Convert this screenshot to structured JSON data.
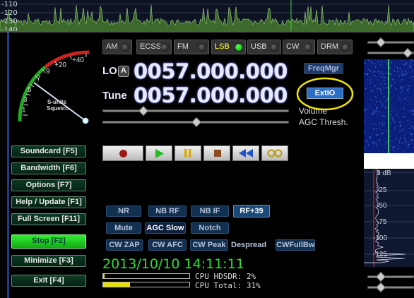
{
  "spectrum_top": {
    "db_labels": [
      "-110",
      "-120",
      "-130",
      "-140"
    ]
  },
  "modes": [
    {
      "label": "AM",
      "active": false
    },
    {
      "label": "ECSS",
      "active": false
    },
    {
      "label": "FM",
      "active": false
    },
    {
      "label": "LSB",
      "active": true
    },
    {
      "label": "USB",
      "active": false
    },
    {
      "label": "CW",
      "active": false
    },
    {
      "label": "DRM",
      "active": false
    }
  ],
  "frequency": {
    "lo_label": "LO",
    "lo_badge": "A",
    "lo_value": "0057.000.000",
    "tune_label": "Tune",
    "tune_value": "0057.000.000"
  },
  "right_buttons": {
    "freqmgr": "FreqMgr",
    "extio": "ExtIO"
  },
  "labels": {
    "volume": "Volume",
    "agc_thresh": "AGC Thresh."
  },
  "smeter": {
    "scale": [
      "1",
      "3",
      "5",
      "7",
      "9",
      "+20",
      "+40"
    ],
    "caption1": "S-units",
    "caption2": "Squelch"
  },
  "sidebar": [
    {
      "label": "Soundcard [F5]"
    },
    {
      "label": "Bandwidth [F6]"
    },
    {
      "label": "Options   [F7]"
    },
    {
      "label": "Help / Update [F1]"
    },
    {
      "label": "Full Screen [F11]"
    },
    {
      "label": "Stop          [F2]"
    },
    {
      "label": "Minimize  [F3]"
    },
    {
      "label": "Exit          [F4]"
    }
  ],
  "dsp": {
    "row1": [
      "NR",
      "NB RF",
      "NB IF",
      "RF+39"
    ],
    "row2": [
      "Mute",
      "AGC Slow",
      "Notch"
    ],
    "row3": [
      "CW ZAP",
      "CW AFC",
      "CW Peak",
      "Despread",
      "CWFullBw"
    ]
  },
  "datetime": "2013/10/10 14:11:11",
  "cpu": {
    "hdsdr_label": "CPU HDSDR:",
    "hdsdr_value": "2%",
    "total_label": "CPU Total:",
    "total_value": "31%",
    "hdsdr_fraction": 0.02,
    "total_fraction": 0.31
  },
  "right_spectrum": {
    "db_labels": [
      "0 dB",
      "-25",
      "-50",
      "-75",
      "-100",
      "-125"
    ]
  },
  "colors": {
    "accent": "#3a8ad8",
    "highlight_circle": "#f2e600",
    "datetime": "#33dd33",
    "lsb_led": "#22dd22"
  }
}
